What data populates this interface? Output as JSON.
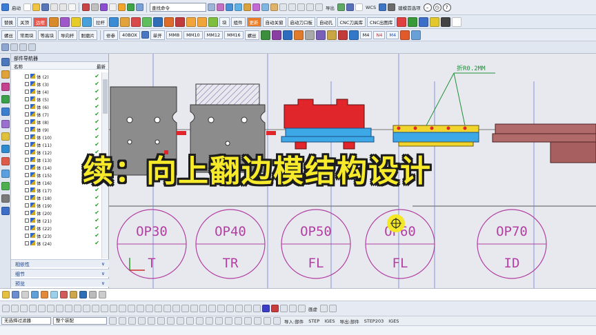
{
  "toolbar1": {
    "start_label": "启动",
    "search_value": "查找命令",
    "export_label": "导出",
    "wcs_label": "WCS",
    "smart_label": "建模首选项"
  },
  "toolbar2": {
    "buttons": [
      "替换",
      "关顶",
      "边框",
      "拉杆",
      "块",
      "组件",
      "更新",
      "自动关窗",
      "启动刀口板",
      "自动孔",
      "CNC刀具库",
      "CNC出图库"
    ]
  },
  "toolbar3": {
    "buttons": [
      "螺丝",
      "常用块",
      "等高块",
      "导向杆",
      "耐磨片",
      "修参",
      "40BOX",
      "单开",
      "MM8",
      "MM10",
      "MM12",
      "MM16",
      "螺丝",
      "M4",
      "N4",
      "M4"
    ]
  },
  "navigator": {
    "title": "部件导航器",
    "col_name": "名称",
    "col_latest": "最新",
    "items": [
      "体 (2)",
      "体 (3)",
      "体 (4)",
      "体 (5)",
      "体 (6)",
      "体 (7)",
      "体 (8)",
      "体 (9)",
      "体 (10)",
      "体 (11)",
      "体 (12)",
      "体 (13)",
      "体 (14)",
      "体 (15)",
      "体 (16)",
      "体 (17)",
      "体 (18)",
      "体 (19)",
      "体 (20)",
      "体 (21)",
      "体 (22)",
      "体 (23)",
      "体 (24)"
    ],
    "panels": [
      "相依性",
      "细节",
      "预览"
    ]
  },
  "viewport": {
    "annotation": "折R0.2MM",
    "stations": [
      {
        "op": "OP30",
        "code": "T"
      },
      {
        "op": "OP40",
        "code": "TR"
      },
      {
        "op": "OP50",
        "code": "FL"
      },
      {
        "op": "OP60",
        "code": "FL"
      },
      {
        "op": "OP70",
        "code": "ID"
      }
    ]
  },
  "banner": "续：向上翻边模结构设计",
  "bottom": {
    "filter_label": "无选择过滤器",
    "assembly_label": "整个装配",
    "import_label": "导入:部件",
    "step_label": "STEP",
    "iges_label": "IGES",
    "export_part_label": "导出:部件",
    "step203_label": "STEP203",
    "iges2_label": "IGES",
    "draw_label": "画虚"
  },
  "colors": {
    "red_plate": "#e0262b",
    "blue_plate": "#3ca9e6",
    "yellow_plate": "#f2d52c",
    "brown_plate": "#b06a6a",
    "gray_plate": "#8c8c8c",
    "circle": "#b23fa2",
    "banner_yellow": "#f6ea2b"
  }
}
